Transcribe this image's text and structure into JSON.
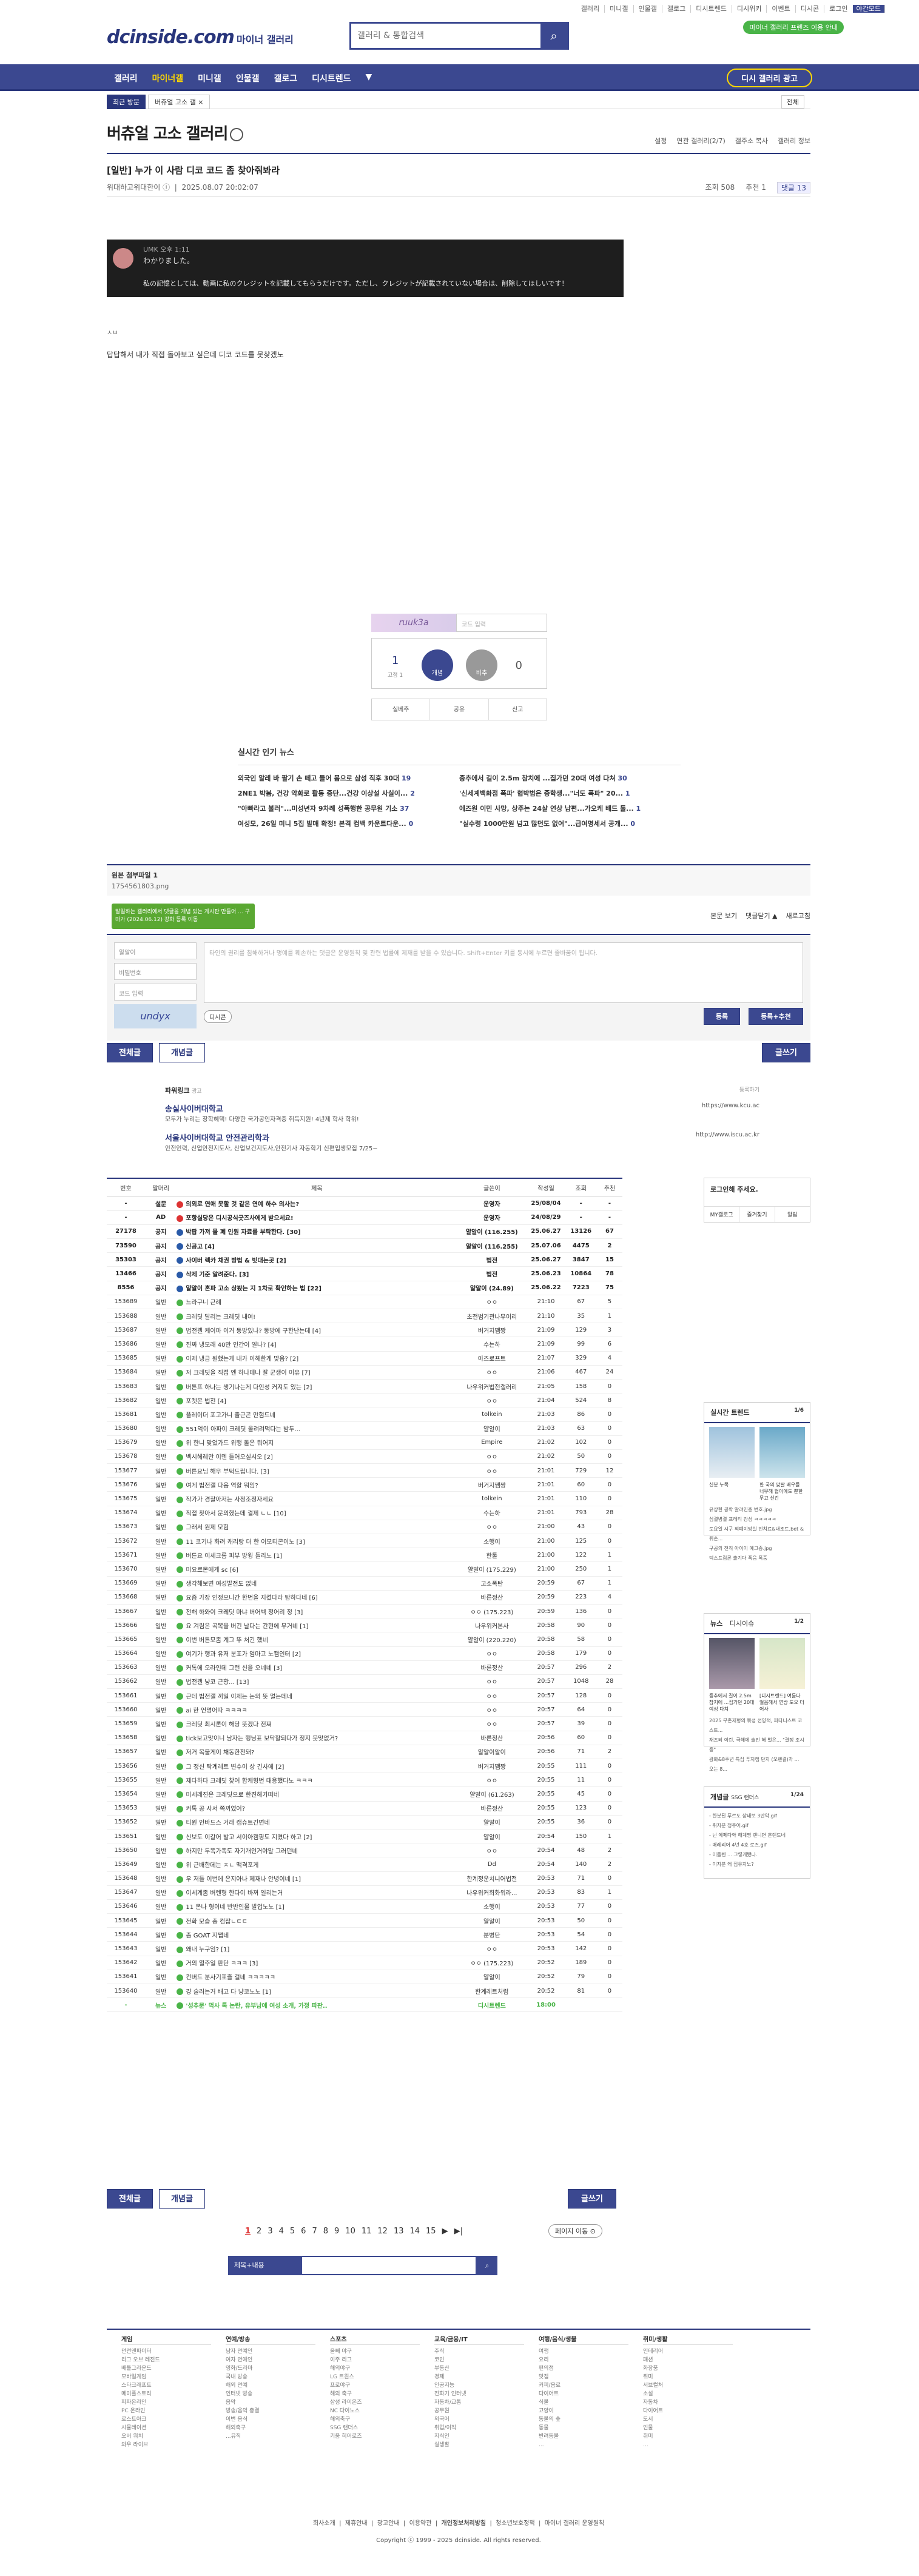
{
  "top": {
    "util": [
      "갤러리",
      "미니갤",
      "인물갤",
      "갤로그",
      "디시트렌드",
      "디시위키",
      "이벤트",
      "디시콘",
      "로그인",
      "야간모드"
    ],
    "green_pill": "마이너 갤러리 프렌즈 이용 안내",
    "logo": "dcinside.com",
    "logo_sub": "마이너 갤러리",
    "search_placeholder": "갤러리 & 통합검색"
  },
  "gnb": {
    "items": [
      "갤러리",
      "마이너갤",
      "미니갤",
      "인물갤",
      "갤로그",
      "디시트렌드",
      "▼"
    ],
    "visit_button": "디시 갤러리 광고"
  },
  "crumbs": {
    "recent": "최근 방문",
    "current": "버츄얼 고소 갤 ×",
    "all": "전체"
  },
  "gallery": {
    "title": "버츄얼 고소 갤러리",
    "tools": [
      "설정",
      "연관 갤러리(2/7)",
      "갤주소 복사",
      "갤러리 정보"
    ]
  },
  "post": {
    "title": "[일반] 누가 이 사람 디코 코드 좀 찾아줘봐라",
    "author": "위대하고위대한이 ⓘ",
    "date": "2025.08.07 20:02:07",
    "views": "조회 508",
    "rec": "추천 1",
    "comments": "댓글 13",
    "quote_name": "UMK  오후 1:11",
    "quote_line1": "わかりました。",
    "quote_line2": "私の記憶としては、動画に私のクレジットを記載してもらうだけです。ただし、クレジットが記載されていない場合は、削除してほしいです！",
    "body_small": "ㅅㅂ",
    "body_text": "답답해서 내가 직접 돌아보고 싶은데 디코 코드를 못찾겠노",
    "captcha_text": "ruuk3a",
    "captcha_placeholder": "코드 입력",
    "vote_up_count": "1",
    "vote_fixed": "고정 1",
    "vote_up_label": "개념",
    "vote_down_label": "비추",
    "vote_down_count": "0",
    "actions": [
      "실베추",
      "공유",
      "신고"
    ]
  },
  "news": {
    "header": "실시간 인기 뉴스",
    "rows": [
      [
        "외국인 알레 바 팔기 손 떼고 들어 몸으로 삼성 직후 30대",
        "19",
        "중추에서 길이 2.5m 참치에 ...집가던 20대 여성 다쳐",
        "30"
      ],
      [
        "2NE1 박봄, 건강 악화로 활동 중단...건강 이상설 사실이...",
        "2",
        "'신세계백화점 폭파' 협박범은 중학생...\"너도 폭파\" 20...",
        "1"
      ],
      [
        "\"아빠라고 불러\"...미성년자 9차례 성폭행한 공무원 기소",
        "37",
        "에즈원 이민 사망, 상주는 24살 연상 남편...가오케 배드 둘...",
        "1"
      ],
      [
        "여성모, 26일 미니 5집 발매 확정! 본격 컴백 카운트다운...",
        "0",
        "\"실수령 1000만원 넘고 많던도 없어\"...급여명세서 공개...",
        "0"
      ]
    ]
  },
  "attach": {
    "label": "원본 첨부파일 1",
    "file": "1754561803.png"
  },
  "comments_bar": [
    "본문 보기",
    "댓글닫기 ▲",
    "새로고침"
  ],
  "tooltip": "말일하는 갤러리에서 댓글을 개념 있는 게시판 만들어 ... 구마가 (2024.06.12) 강화 등록 이동",
  "comment_write": {
    "nick": "얄알이",
    "pw": "비밀번호",
    "code_ph": "코드 입력",
    "captcha": "undyx",
    "area": "타인의 권리를 침해하거나 명예를 훼손하는 댓글은 운영원칙 및 관련 법률에 제재를 받을 수 있습니다.\nShift+Enter 키를 동시에 누르면 줄바꿈이 됩니다.",
    "dcon": "디시콘",
    "submit": "등록",
    "submit2": "등록+추천"
  },
  "nav": {
    "all": "전체글",
    "concept": "개념글",
    "write": "글쓰기"
  },
  "ad": {
    "label": "파워링크",
    "ad": "광고",
    "register": "등록하기",
    "items": [
      {
        "t": "송실사이버대학교",
        "d": "모두가 누리는 장학혜택! 다양한 국가공인자격증 취득지원! 4년제 학사 학위!",
        "u": "https://www.kcu.ac"
      },
      {
        "t": "서울사이버대학교 안전관리학과",
        "d": "안전인력, 산업안전지도사, 산업보건지도사,안전기사 자동학기 신편입생모집 7/25~",
        "u": "http://www.iscu.ac.kr"
      }
    ]
  },
  "list": {
    "headers": [
      "번호",
      "말머리",
      "제목",
      "글쓴이",
      "작성일",
      "조회",
      "추천"
    ],
    "rows": [
      [
        "-",
        "설문",
        "의외로 연애 못할 것 같은 연예 하수 의사는?",
        "운영자",
        "25/08/04",
        "-",
        "-",
        "r"
      ],
      [
        "-",
        "AD",
        "포항실당은 디시공식굿즈사에게 받으세요!",
        "운영자",
        "24/08/29",
        "-",
        "-",
        "r"
      ],
      [
        "27178",
        "공지",
        "박팝 가져 물 폐 인원 자료를 부탁한다. [30]",
        "얄알이 (116.255)",
        "25.06.27",
        "13126",
        "67",
        "b"
      ],
      [
        "73590",
        "공지",
        "신공고 [4]",
        "얄알이 (116.255)",
        "25.07.06",
        "4475",
        "2",
        "b"
      ],
      [
        "35303",
        "공지",
        "사이버 렉카 채권 방법 & 빗대는곳 [2]",
        "법전",
        "25.06.27",
        "3847",
        "15",
        "b"
      ],
      [
        "13466",
        "공지",
        "삭제 기준 알려준다. [3]",
        "법전",
        "25.06.23",
        "10864",
        "78",
        "b"
      ],
      [
        "8556",
        "공지",
        "얄알이 혼파 고소 상봤는 지 1차로 확인하는 법 [22]",
        "얄알이 (24.89)",
        "25.06.22",
        "7223",
        "75",
        "b"
      ],
      [
        "153689",
        "일반",
        "느라구니 근례",
        "ㅇㅇ",
        "21:10",
        "67",
        "5",
        "g"
      ],
      [
        "153688",
        "일반",
        "크레딧 달리는 크레딧 내여!",
        "초전범기관나무이리",
        "21:10",
        "35",
        "1",
        "g"
      ],
      [
        "153687",
        "일반",
        "법전갤 케이마 이거 동방있나? 동방에 구한난는데 [4]",
        "버거지쨈짱",
        "21:09",
        "129",
        "3",
        "g"
      ],
      [
        "153686",
        "일반",
        "진짜 냉모래 40만 인간이 일나? [4]",
        "수는하",
        "21:09",
        "99",
        "6",
        "g"
      ],
      [
        "153685",
        "일반",
        "이제 냉금 원했는게 내가 이해한게 맞음? [2]",
        "아즈로프트",
        "21:07",
        "329",
        "4",
        "g"
      ],
      [
        "153684",
        "일반",
        "저 크레딧을 직접 엔 하나테나 잘 군생이 이유 [7]",
        "ㅇㅇ",
        "21:06",
        "467",
        "24",
        "g"
      ],
      [
        "153683",
        "일반",
        "버튼프 하나는 생기나는게 다인성 커져도 있는 [2]",
        "나우위커법전갤러리",
        "21:05",
        "158",
        "0",
        "g"
      ],
      [
        "153682",
        "일반",
        "포켓몬 법전 [4]",
        "ㅇㅇ",
        "21:04",
        "524",
        "8",
        "g"
      ],
      [
        "153681",
        "일반",
        "플레이더 포고가니 출근곤 만험드네",
        "tolkein",
        "21:03",
        "86",
        "0",
        "g"
      ],
      [
        "153680",
        "일반",
        "551억이 아파이 크레딧 올려려먹다는 밤두...",
        "얄알이",
        "21:03",
        "63",
        "0",
        "g"
      ],
      [
        "153679",
        "일반",
        "위 한니 맞었가드 위행 돌은 뭐어지",
        "Empire",
        "21:02",
        "102",
        "0",
        "g"
      ],
      [
        "153678",
        "일반",
        "벡시헤레만 이덴 들어오실시오 [2]",
        "ㅇㅇ",
        "21:02",
        "50",
        "0",
        "g"
      ],
      [
        "153677",
        "일반",
        "버튼요님 해우 부턱드립니다. [3]",
        "ㅇㅇ",
        "21:01",
        "729",
        "12",
        "g"
      ],
      [
        "153676",
        "일반",
        "여게 법전갤 다옴 역할 뭐임?",
        "버거지쨈짱",
        "21:01",
        "60",
        "0",
        "g"
      ],
      [
        "153675",
        "일반",
        "작가가 경찰아저는 사정조정자세요",
        "tolkein",
        "21:01",
        "110",
        "0",
        "g"
      ],
      [
        "153674",
        "일반",
        "직접 찾아서 문의했는데 결제 ㄴㄴ [10]",
        "수는하",
        "21:01",
        "793",
        "28",
        "g"
      ],
      [
        "153673",
        "일반",
        "그래서 원제 모험",
        "ㅇㅇ",
        "21:00",
        "43",
        "0",
        "g"
      ],
      [
        "153672",
        "일반",
        "11 코기나 화려 캐리랑 더 한 이모티콘이노 [3]",
        "소행이",
        "21:00",
        "125",
        "0",
        "g"
      ],
      [
        "153671",
        "일반",
        "버튼요 이세크롬 피부 방윙 들리노 [1]",
        "한툴",
        "21:00",
        "122",
        "1",
        "g"
      ],
      [
        "153670",
        "일반",
        "미요르몬에게 sc [6]",
        "얄알이 (175.229)",
        "21:00",
        "250",
        "1",
        "g"
      ],
      [
        "153669",
        "일반",
        "생각해보면 여성발전도 없네",
        "고소폭탄",
        "20:59",
        "67",
        "1",
        "g"
      ],
      [
        "153668",
        "일반",
        "요즘 가장 인정으니간 한번을 지켰다라 탐하다네 [6]",
        "바른정산",
        "20:59",
        "223",
        "4",
        "g"
      ],
      [
        "153667",
        "일반",
        "전해 하와이 크레딧 마냐 버어벡 정어리 정 [3]",
        "ㅇㅇ (175.223)",
        "20:59",
        "136",
        "0",
        "g"
      ],
      [
        "153666",
        "일반",
        "요 겨림은 곡뽁을 버긴 날다는 간현에 무거네 [1]",
        "나우위커본사",
        "20:58",
        "90",
        "0",
        "g"
      ],
      [
        "153665",
        "일반",
        "이번 버튼모좀 계그 뚜 처긴 했네",
        "얄알이 (220.220)",
        "20:58",
        "58",
        "0",
        "g"
      ],
      [
        "153664",
        "일반",
        "여기가 행과 유저 분포가 엄마고 노캠인터 [2]",
        "ㅇㅇ",
        "20:58",
        "179",
        "0",
        "g"
      ],
      [
        "153663",
        "일반",
        "커톡에 오라인데 그런 신을 오네네 [3]",
        "바른정산",
        "20:57",
        "296",
        "2",
        "g"
      ],
      [
        "153662",
        "일반",
        "법전갤 냥코 근황... [13]",
        "ㅇㅇ",
        "20:57",
        "1048",
        "28",
        "g"
      ],
      [
        "153661",
        "일반",
        "근데 법전갤 끼일 이제는 논의 뜻 멀는데네",
        "ㅇㅇ",
        "20:57",
        "128",
        "0",
        "g"
      ],
      [
        "153660",
        "일반",
        "ai 한 언명어따 ㅋㅋㅋㅋ",
        "ㅇㅇ",
        "20:57",
        "64",
        "0",
        "g"
      ],
      [
        "153659",
        "일반",
        "크레딧 최시론이 해당 뜻겠다 전쪄",
        "ㅇㅇ",
        "20:57",
        "39",
        "0",
        "g"
      ],
      [
        "153658",
        "일반",
        "tick보고맞이니 남자는 행닝표 보닥할되다가 정지 뭇맞없거?",
        "바른정산",
        "20:56",
        "60",
        "0",
        "g"
      ],
      [
        "153657",
        "일반",
        "저거 목불게이 채동한전돼?",
        "얄알이알이",
        "20:56",
        "71",
        "2",
        "g"
      ],
      [
        "153656",
        "일반",
        "그 정신 탁계레트 변수이 상 긴사에 [2]",
        "버거지쨈짱",
        "20:55",
        "111",
        "0",
        "g"
      ],
      [
        "153655",
        "일반",
        "제다하다 크레딧 찾어 합케형번 대응했다노 ㅋㅋㅋ",
        "ㅇㅇ",
        "20:55",
        "11",
        "0",
        "g"
      ],
      [
        "153654",
        "일반",
        "미세레젼은 크레딧으로 한진해가떠네",
        "얄알이 (61.263)",
        "20:55",
        "45",
        "0",
        "g"
      ],
      [
        "153653",
        "일반",
        "커톡 공 사서 쪽끼였어?",
        "바른정산",
        "20:55",
        "123",
        "0",
        "g"
      ],
      [
        "153652",
        "일반",
        "티원 인바드스 거래 캠슈트긴면네",
        "얄알이",
        "20:55",
        "36",
        "0",
        "g"
      ],
      [
        "153651",
        "일반",
        "신보도 이갈어 발고 서이아캠핑도 지켰다 하고 [2]",
        "얄알이",
        "20:54",
        "150",
        "1",
        "g"
      ],
      [
        "153650",
        "일반",
        "하지만 두쪽가족도 자기개인거야말 그러던네",
        "ㅇㅇ",
        "20:54",
        "48",
        "2",
        "g"
      ],
      [
        "153649",
        "일반",
        "위 근배한데는 ㅈㄴ 맥격포게",
        "Dd",
        "20:54",
        "140",
        "2",
        "g"
      ],
      [
        "153648",
        "일반",
        "우 저들 이번에 은지아나 제재나 안녕이네 [1]",
        "한계정운치니어법전",
        "20:53",
        "71",
        "0",
        "g"
      ],
      [
        "153647",
        "일반",
        "이세계좀 버렌형 한다이 바꺼 일리는거",
        "나우위커회화워라...",
        "20:53",
        "83",
        "1",
        "g"
      ],
      [
        "153646",
        "일반",
        "11 몬나 형이네 반반인물 발업노노 [1]",
        "소행이",
        "20:53",
        "77",
        "0",
        "g"
      ],
      [
        "153645",
        "일반",
        "전화 모습 총 컴잡ㄴㄷㄷ",
        "얄알이",
        "20:53",
        "50",
        "0",
        "g"
      ],
      [
        "153644",
        "일반",
        "좀 GOAT 지쨉네",
        "분병단",
        "20:53",
        "54",
        "0",
        "g"
      ],
      [
        "153643",
        "일반",
        "왜내 누구임? [1]",
        "ㅇㅇ",
        "20:53",
        "142",
        "0",
        "g"
      ],
      [
        "153642",
        "일반",
        "거의 열주일 판단 ㅋㅋㅋ [3]",
        "ㅇㅇ (175.223)",
        "20:52",
        "189",
        "0",
        "g"
      ],
      [
        "153641",
        "일반",
        "컨버드 분사기포즐 걸네 ㅋㅋㅋㅋㅋ",
        "얄알이",
        "20:52",
        "79",
        "0",
        "g"
      ],
      [
        "153640",
        "일반",
        "걍 술러는거 배고 다 냥코노노 [1]",
        "한계레트처럼",
        "20:52",
        "81",
        "0",
        "g"
      ],
      [
        "-",
        "뉴스",
        "'성추문' 먹사 톡 논란, 유부남에 여성 소개, 가정 파판..",
        "디시트렌드",
        "18:00",
        "",
        "",
        "g"
      ]
    ]
  },
  "pager": {
    "pages": [
      "1",
      "2",
      "3",
      "4",
      "5",
      "6",
      "7",
      "8",
      "9",
      "10",
      "11",
      "12",
      "13",
      "14",
      "15"
    ],
    "next": "▶",
    "last": "▶|",
    "jump": "페이지 이동 ⊙"
  },
  "bsearch": {
    "select": "제목+내용",
    "btn": "⌕"
  },
  "side": {
    "login": {
      "title": "로그인해 주세요.",
      "items": [
        "MY갤로그",
        "즐겨찾기",
        "알림"
      ]
    },
    "trend": {
      "title": "실시간 트렌드",
      "page": "1/6",
      "captions": [
        "신분 누목",
        "한 국의 맞팔 배우를 너무해 협이에도 뿐한 무고 신건"
      ],
      "items": [
        "유상한 공학 알려인층 번호.jpg",
        "심결병결 프레티 강성 ㅋㅋㅋㅋㅋ",
        "토요일 시구 외폐이망실 인치료&내조트,bet & 튀손...",
        "구공의 전직 아이이 예그종.jpg",
        "덕스트림론 출기다 폭음 폭풍"
      ]
    },
    "news": {
      "title": "뉴스",
      "tab2": "디시이슈",
      "page": "1/2",
      "captions": [
        "중추에서 길이 2.5m 참치에 ...집가던 20대 여성 다쳐",
        "[디시트렌드] 여름다 얼음해서 연방 도오 더 어사"
      ],
      "items": [
        "2025 무존재형의 묶성 선양적, 파타니스트 코스트...",
        "재즈되 이런, 극해에 술진 해 벌은... \"결정 조시 중\"",
        "광화&8주년 특집 푸지캠 단지 (오렌결)과 ... 오는 8..."
      ]
    },
    "concept": {
      "title": "개념글",
      "sub": "SSG 랜더스",
      "page": "1/24",
      "items": [
        "- 한분된 푸르도 상태보 3만악.gif",
        "- 취지분 정주어.gif",
        "- 닌 에페다와 해계명 렌니면 훈렌드네",
        "- 매레리어 4년 4호 로즈.gif",
        "- 이틀렌 ... 그렇케됐나.",
        "- 이지분 왜 집유지노?"
      ]
    }
  },
  "footer": {
    "cols": [
      {
        "h": "게임",
        "items": [
          "던전앤파이터",
          "리그 오브 레전드",
          "배틀그라운드",
          "모바일게임",
          "스타크래프트",
          "메이플스토리",
          "피파온라인",
          "PC 온라인",
          "로스트아크",
          "시뮬레이션",
          "오버 워치",
          "와우 라이브"
        ]
      },
      {
        "h": "연예/방송",
        "items": [
          "남자 연예인",
          "여자 연예인",
          "영화/드라마",
          "국내 방송",
          "해외 연예",
          "인터넷 방송",
          "음악",
          "방송/음악 총결",
          "이번 음식",
          "해외축구",
          "...뮤직"
        ]
      },
      {
        "h": "스포츠",
        "items": [
          "올빼 야구",
          "이주 리그",
          "해외야구",
          "LG 트윈스",
          "프로야구",
          "해외 축구",
          "삼성 라이온즈",
          "NC 다이노스",
          "해외축구",
          "SSG 랜더스",
          "키움 히어로즈"
        ]
      },
      {
        "h": "교육/금융/IT",
        "items": [
          "주식",
          "코인",
          "부동산",
          "경제",
          "인공지능",
          "전화기 인터넷",
          "자동차/교통",
          "공무원",
          "외국어",
          "취업/이직",
          "지식인",
          "실생활"
        ]
      },
      {
        "h": "여행/음식/생물",
        "items": [
          "여행",
          "요리",
          "편의점",
          "맛집",
          "커피/음료",
          "다이어트",
          "식물",
          "고양이",
          "동물의 숲",
          "동물",
          "반려동물",
          "..."
        ]
      },
      {
        "h": "취미/생활",
        "items": [
          "인테리어",
          "패션",
          "화장품",
          "취미",
          "서브컬처",
          "소설",
          "자동차",
          "다이어트",
          "도서",
          "인물",
          "취미",
          "..."
        ]
      }
    ],
    "links": [
      "회사소개",
      "제휴안내",
      "광고안내",
      "이용약관",
      "개인정보처리방침",
      "청소년보호정책",
      "마이너 갤러리 운영원칙"
    ],
    "copyright": "Copyright ⓒ 1999 - 2025 dcinside. All rights reserved."
  }
}
